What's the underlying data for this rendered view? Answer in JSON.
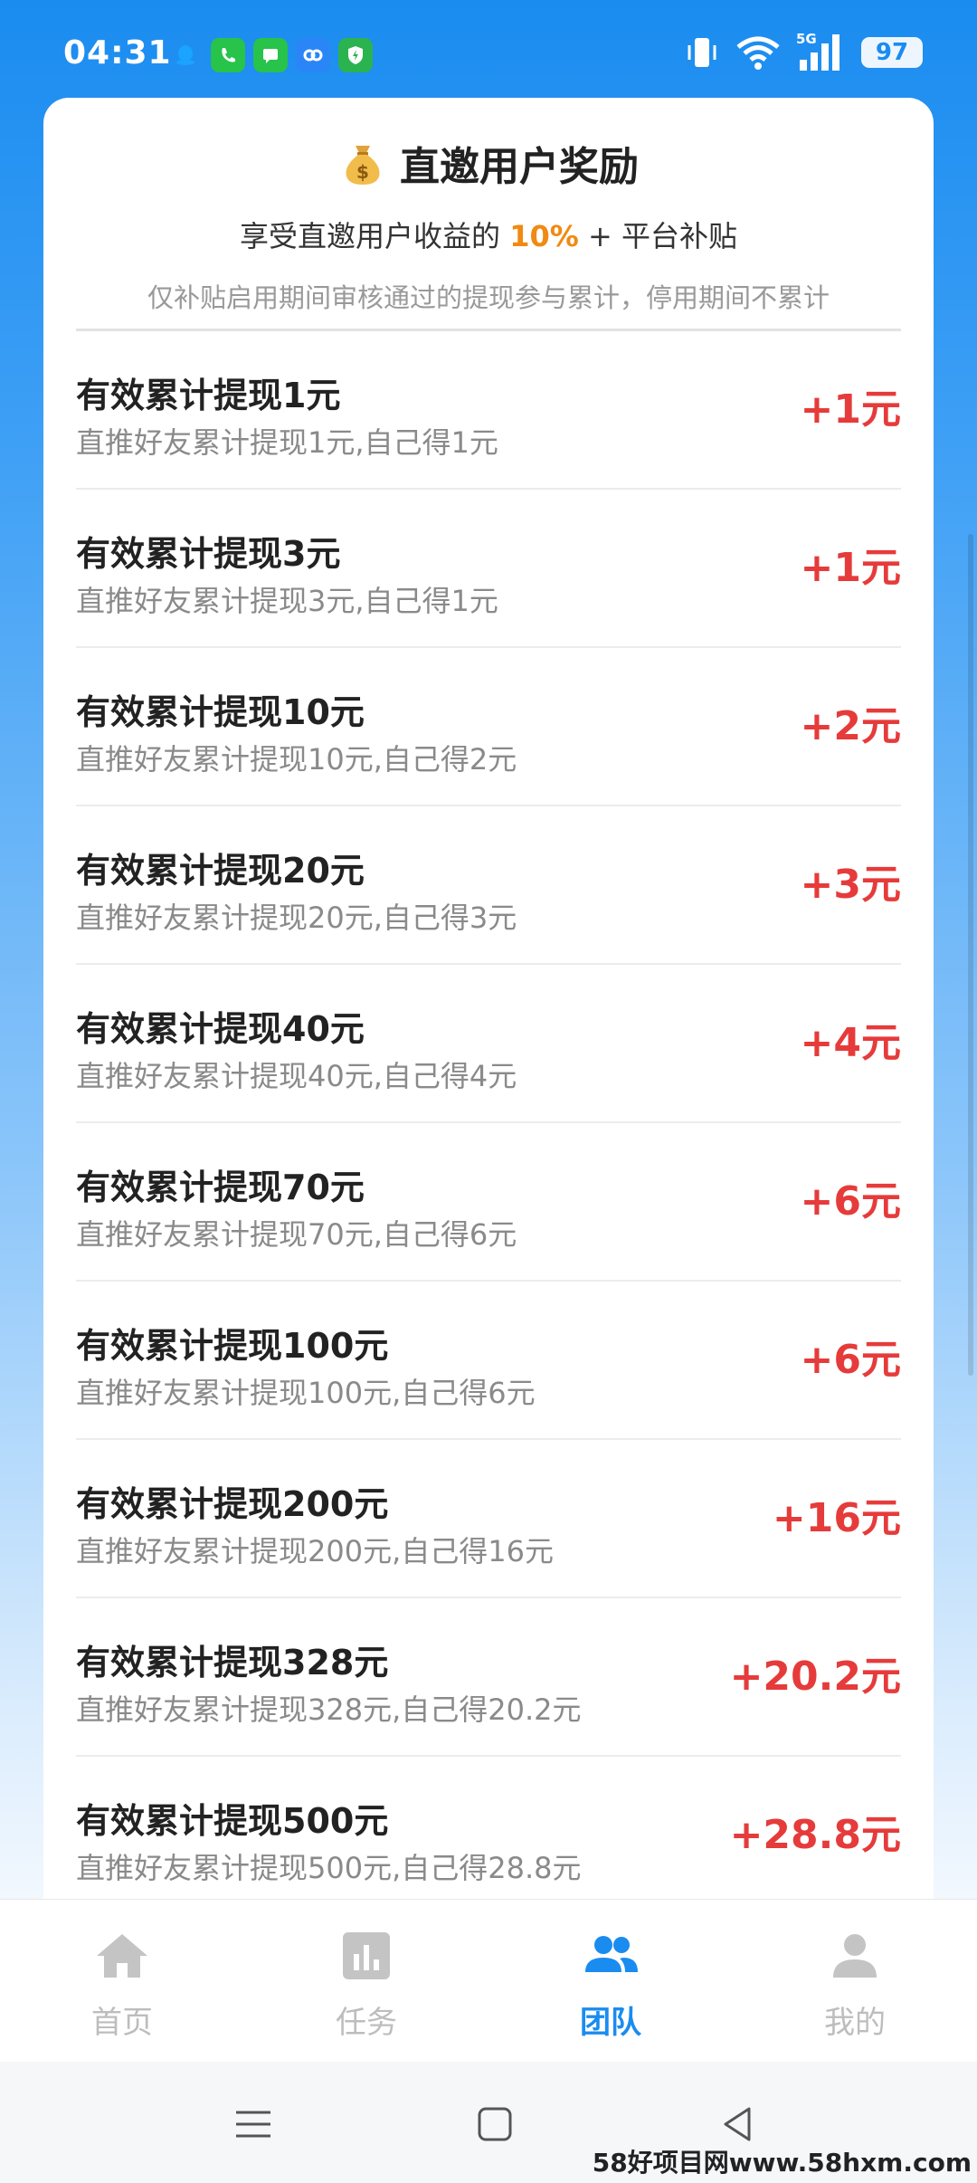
{
  "status_bar": {
    "time": "04:31",
    "notifications": [
      {
        "icon": "qq-icon",
        "color": "#1aa3ff"
      },
      {
        "icon": "phone-icon",
        "color": "#27c34a"
      },
      {
        "icon": "message-icon",
        "color": "#27c34a"
      },
      {
        "icon": "link-app-icon",
        "color": "#2a86f6"
      },
      {
        "icon": "shield-app-icon",
        "color": "#2bb34f"
      }
    ],
    "network": "5G",
    "battery": "97"
  },
  "card": {
    "title": "直邀用户奖励",
    "subtitle_prefix": "享受直邀用户收益的",
    "subtitle_rate": "10%",
    "subtitle_suffix": "+ 平台补贴",
    "note": "仅补贴启用期间审核通过的提现参与累计，停用期间不累计"
  },
  "rewards": [
    {
      "title": "有效累计提现1元",
      "desc": "直推好友累计提现1元,自己得1元",
      "reward": "+1元"
    },
    {
      "title": "有效累计提现3元",
      "desc": "直推好友累计提现3元,自己得1元",
      "reward": "+1元"
    },
    {
      "title": "有效累计提现10元",
      "desc": "直推好友累计提现10元,自己得2元",
      "reward": "+2元"
    },
    {
      "title": "有效累计提现20元",
      "desc": "直推好友累计提现20元,自己得3元",
      "reward": "+3元"
    },
    {
      "title": "有效累计提现40元",
      "desc": "直推好友累计提现40元,自己得4元",
      "reward": "+4元"
    },
    {
      "title": "有效累计提现70元",
      "desc": "直推好友累计提现70元,自己得6元",
      "reward": "+6元"
    },
    {
      "title": "有效累计提现100元",
      "desc": "直推好友累计提现100元,自己得6元",
      "reward": "+6元"
    },
    {
      "title": "有效累计提现200元",
      "desc": "直推好友累计提现200元,自己得16元",
      "reward": "+16元"
    },
    {
      "title": "有效累计提现328元",
      "desc": "直推好友累计提现328元,自己得20.2元",
      "reward": "+20.2元"
    },
    {
      "title": "有效累计提现500元",
      "desc": "直推好友累计提现500元,自己得28.8元",
      "reward": "+28.8元"
    }
  ],
  "bottom_nav": [
    {
      "label": "首页",
      "icon": "home-icon"
    },
    {
      "label": "任务",
      "icon": "chart-icon"
    },
    {
      "label": "团队",
      "icon": "team-icon",
      "active": true
    },
    {
      "label": "我的",
      "icon": "user-icon"
    }
  ],
  "colors": {
    "accent": "#1a8cf0",
    "reward": "#e63b3b",
    "rate": "#f08a12"
  },
  "watermark": "58好项目网www.58hxm.com"
}
